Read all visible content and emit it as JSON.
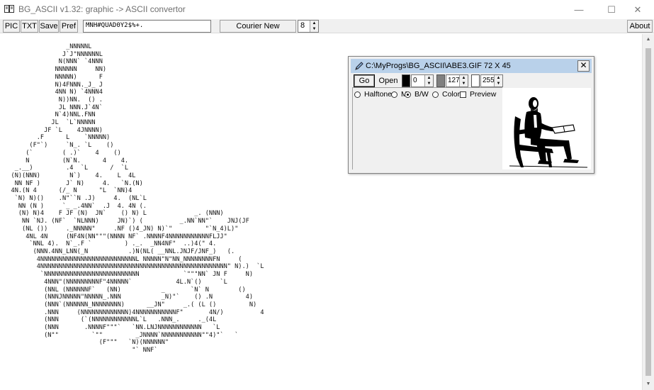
{
  "window": {
    "title": "BG_ASCII v1.32: graphic -> ASCII convertor",
    "minimize": "—",
    "maximize": "☐",
    "close": "✕"
  },
  "toolbar": {
    "pic_label": "PIC",
    "txt_label": "TXT",
    "save_label": "Save",
    "pref_label": "Pref",
    "charset_value": "MNH#QUAD0Y2$%+.",
    "font_label": "Courier New",
    "font_size_value": "8",
    "about_label": "About"
  },
  "ascii_art": "                  _NNNNNL\n                 J`J\"NNNNNNL\n                N(NNN` `4NNN\n               NNNNNN     NN)\n               NNNNN)      F\n               N)4FNNN._J_ J\n               4NN N) `4NNN4\n                N))NN.  () .\n                JL NNN.J`4N`\n               N`4)NNL.FNN\n              JL  `L`NNNNN\n            JF `L    4JNNNN)\n          .F      L    `NNNNN)\n        (F\"`)     `N_. `L    ()\n       (`        ( .)`    4    ()\n       N         (N`N.      4    4.\n    _.__)         .4  `L      /  `L\n   (N)(NNN)        N`)    4.    L  4L\n    NN NF )       J` N)     4.   `N.(N)\n   4N.(N 4      (/_ N      \"L  `NN)4\n    `N) N)()    .N\"``N .J)     4.  (NL`L\n     NN (N )     `_ _.4NN`  .J  4. 4N (.\n     (N) N)4    F JF (N)  JN`    () N) L             _. (NNN)\n      NN `NJ. (NF`  `NLNNN)     JN)`) (          _.NN`NN\"`    JNJ(JF\n      (NL ())     ._NNNNN\"     .NF ()4_JN) N)`\"         \"`N_4)L)\"\n       4NL 4N     (NF4N(NN\"\"\"(NNNN NF` .NNNNF4NNNNNNNNNNNFLJJ\"\n        `NNL 4).  N`_.F `         ) ._.  _NN4NF\"  ..)4(\" 4.\n         (NNN.4NN_LNN(_N           .)N(NL( __NNL.JNJF/JNF_)   (.\n          4NNNNNNNNNNNNNNNNNNNNNNNNNNL NNNNN\"N\"NN_NNNNNNNNFN     (\n          4NNNNNNNNNNNNNNNNNNNNNNNNNNNNNNNNNNNNNNNNNNNNNNNNNNN\" N).)  `L\n           `NNNNNNNNNNNNNNNNNNNNNNNNNN            `\"\"\"NN` JN F     N)\n            4NNN\"(NNNNNNNNNF\"4NNNNN`            4L.N`()     `L\n            (NNL (NNNNNNF`   (NN)           _       `N` N        ()\n            (NNNJNNNNN\"NNNNN_.NNN           _N)\"`    () .N         4)\n            (NNN`(NNNNNN_NNNNNNNN)      __JN\"     _.( (L ()         N)\n            .NNN     (NNNNNNNNNNNNN)4NNNNNNNNNNNF\"       4N/)          4\n            (NNN      (`(NNNNNNNNNNNNL`L   .NNN_.     ._(4L\n            (NNN       .NNNNF\"\"\"`   `NN.LNJNNNNNNNNNNNN   `L\n            (N\"\"         `\"\"         _JNNNN`NNNNNNNNNNN\"\"4)\"`   `\n                           (F\"\"\"   `N)(NNNNNN\"\n                                    \"` NNF`",
  "child": {
    "title": "C:\\MyProgs\\BG_ASCII\\ABE3.GIF 72 X 45",
    "close": "✕",
    "go_label": "Go",
    "open_label": "Open",
    "black_value": "0",
    "gray_value": "127",
    "white_value": "255",
    "colors": {
      "black": "#000000",
      "gray": "#808080",
      "white": "#ffffff",
      "titlebar": "#b9d1ea"
    },
    "options": [
      {
        "label": "Halftone",
        "kind": "radio",
        "checked": false
      },
      {
        "label": "M",
        "kind": "radio",
        "checked": false
      },
      {
        "label": "B/W",
        "kind": "radio",
        "checked": true
      },
      {
        "label": "Color",
        "kind": "radio",
        "checked": false
      },
      {
        "label": "Preview",
        "kind": "checkbox",
        "checked": false
      }
    ]
  }
}
